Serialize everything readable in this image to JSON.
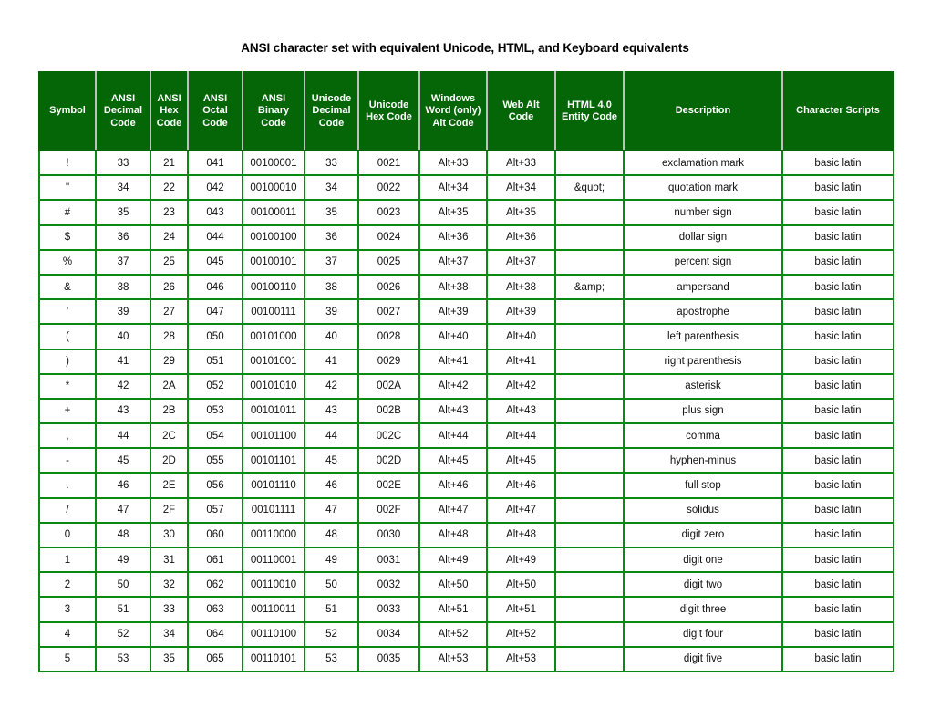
{
  "document": {
    "title": "ANSI character set with equivalent Unicode, HTML, and Keyboard equivalents"
  },
  "colors": {
    "header_background": "#056608",
    "header_text": "#ffffff",
    "header_cell_border": "#c0c0c0",
    "body_cell_border": "#0a8a12",
    "page_background": "#ffffff",
    "body_text": "#111111"
  },
  "table": {
    "columns": [
      {
        "key": "symbol",
        "label": "Symbol"
      },
      {
        "key": "ansi_dec",
        "label": "ANSI Decimal Code"
      },
      {
        "key": "ansi_hex",
        "label": "ANSI Hex Code"
      },
      {
        "key": "ansi_oct",
        "label": "ANSI Octal Code"
      },
      {
        "key": "ansi_bin",
        "label": "ANSI Binary Code"
      },
      {
        "key": "uni_dec",
        "label": "Unicode Decimal Code"
      },
      {
        "key": "uni_hex",
        "label": "Unicode Hex Code"
      },
      {
        "key": "word_alt",
        "label": "Windows Word (only) Alt Code"
      },
      {
        "key": "web_alt",
        "label": "Web Alt Code"
      },
      {
        "key": "html_entity",
        "label": "HTML 4.0 Entity Code"
      },
      {
        "key": "description",
        "label": "Description"
      },
      {
        "key": "scripts",
        "label": "Character Scripts"
      }
    ],
    "rows": [
      {
        "symbol": "!",
        "ansi_dec": "33",
        "ansi_hex": "21",
        "ansi_oct": "041",
        "ansi_bin": "00100001",
        "uni_dec": "33",
        "uni_hex": "0021",
        "word_alt": "Alt+33",
        "web_alt": "Alt+33",
        "html_entity": "",
        "description": "exclamation mark",
        "scripts": "basic latin"
      },
      {
        "symbol": "\"",
        "ansi_dec": "34",
        "ansi_hex": "22",
        "ansi_oct": "042",
        "ansi_bin": "00100010",
        "uni_dec": "34",
        "uni_hex": "0022",
        "word_alt": "Alt+34",
        "web_alt": "Alt+34",
        "html_entity": "&quot;",
        "description": "quotation mark",
        "scripts": "basic latin"
      },
      {
        "symbol": "#",
        "ansi_dec": "35",
        "ansi_hex": "23",
        "ansi_oct": "043",
        "ansi_bin": "00100011",
        "uni_dec": "35",
        "uni_hex": "0023",
        "word_alt": "Alt+35",
        "web_alt": "Alt+35",
        "html_entity": "",
        "description": "number sign",
        "scripts": "basic latin"
      },
      {
        "symbol": "$",
        "ansi_dec": "36",
        "ansi_hex": "24",
        "ansi_oct": "044",
        "ansi_bin": "00100100",
        "uni_dec": "36",
        "uni_hex": "0024",
        "word_alt": "Alt+36",
        "web_alt": "Alt+36",
        "html_entity": "",
        "description": "dollar sign",
        "scripts": "basic latin"
      },
      {
        "symbol": "%",
        "ansi_dec": "37",
        "ansi_hex": "25",
        "ansi_oct": "045",
        "ansi_bin": "00100101",
        "uni_dec": "37",
        "uni_hex": "0025",
        "word_alt": "Alt+37",
        "web_alt": "Alt+37",
        "html_entity": "",
        "description": "percent sign",
        "scripts": "basic latin"
      },
      {
        "symbol": "&",
        "ansi_dec": "38",
        "ansi_hex": "26",
        "ansi_oct": "046",
        "ansi_bin": "00100110",
        "uni_dec": "38",
        "uni_hex": "0026",
        "word_alt": "Alt+38",
        "web_alt": "Alt+38",
        "html_entity": "&amp;",
        "description": "ampersand",
        "scripts": "basic latin"
      },
      {
        "symbol": "'",
        "ansi_dec": "39",
        "ansi_hex": "27",
        "ansi_oct": "047",
        "ansi_bin": "00100111",
        "uni_dec": "39",
        "uni_hex": "0027",
        "word_alt": "Alt+39",
        "web_alt": "Alt+39",
        "html_entity": "",
        "description": "apostrophe",
        "scripts": "basic latin"
      },
      {
        "symbol": "(",
        "ansi_dec": "40",
        "ansi_hex": "28",
        "ansi_oct": "050",
        "ansi_bin": "00101000",
        "uni_dec": "40",
        "uni_hex": "0028",
        "word_alt": "Alt+40",
        "web_alt": "Alt+40",
        "html_entity": "",
        "description": "left parenthesis",
        "scripts": "basic latin"
      },
      {
        "symbol": ")",
        "ansi_dec": "41",
        "ansi_hex": "29",
        "ansi_oct": "051",
        "ansi_bin": "00101001",
        "uni_dec": "41",
        "uni_hex": "0029",
        "word_alt": "Alt+41",
        "web_alt": "Alt+41",
        "html_entity": "",
        "description": "right parenthesis",
        "scripts": "basic latin"
      },
      {
        "symbol": "*",
        "ansi_dec": "42",
        "ansi_hex": "2A",
        "ansi_oct": "052",
        "ansi_bin": "00101010",
        "uni_dec": "42",
        "uni_hex": "002A",
        "word_alt": "Alt+42",
        "web_alt": "Alt+42",
        "html_entity": "",
        "description": "asterisk",
        "scripts": "basic latin"
      },
      {
        "symbol": "+",
        "ansi_dec": "43",
        "ansi_hex": "2B",
        "ansi_oct": "053",
        "ansi_bin": "00101011",
        "uni_dec": "43",
        "uni_hex": "002B",
        "word_alt": "Alt+43",
        "web_alt": "Alt+43",
        "html_entity": "",
        "description": "plus sign",
        "scripts": "basic latin"
      },
      {
        "symbol": ",",
        "ansi_dec": "44",
        "ansi_hex": "2C",
        "ansi_oct": "054",
        "ansi_bin": "00101100",
        "uni_dec": "44",
        "uni_hex": "002C",
        "word_alt": "Alt+44",
        "web_alt": "Alt+44",
        "html_entity": "",
        "description": "comma",
        "scripts": "basic latin"
      },
      {
        "symbol": "-",
        "ansi_dec": "45",
        "ansi_hex": "2D",
        "ansi_oct": "055",
        "ansi_bin": "00101101",
        "uni_dec": "45",
        "uni_hex": "002D",
        "word_alt": "Alt+45",
        "web_alt": "Alt+45",
        "html_entity": "",
        "description": "hyphen-minus",
        "scripts": "basic latin"
      },
      {
        "symbol": ".",
        "ansi_dec": "46",
        "ansi_hex": "2E",
        "ansi_oct": "056",
        "ansi_bin": "00101110",
        "uni_dec": "46",
        "uni_hex": "002E",
        "word_alt": "Alt+46",
        "web_alt": "Alt+46",
        "html_entity": "",
        "description": "full stop",
        "scripts": "basic latin"
      },
      {
        "symbol": "/",
        "ansi_dec": "47",
        "ansi_hex": "2F",
        "ansi_oct": "057",
        "ansi_bin": "00101111",
        "uni_dec": "47",
        "uni_hex": "002F",
        "word_alt": "Alt+47",
        "web_alt": "Alt+47",
        "html_entity": "",
        "description": "solidus",
        "scripts": "basic latin"
      },
      {
        "symbol": "0",
        "ansi_dec": "48",
        "ansi_hex": "30",
        "ansi_oct": "060",
        "ansi_bin": "00110000",
        "uni_dec": "48",
        "uni_hex": "0030",
        "word_alt": "Alt+48",
        "web_alt": "Alt+48",
        "html_entity": "",
        "description": "digit zero",
        "scripts": "basic latin"
      },
      {
        "symbol": "1",
        "ansi_dec": "49",
        "ansi_hex": "31",
        "ansi_oct": "061",
        "ansi_bin": "00110001",
        "uni_dec": "49",
        "uni_hex": "0031",
        "word_alt": "Alt+49",
        "web_alt": "Alt+49",
        "html_entity": "",
        "description": "digit one",
        "scripts": "basic latin"
      },
      {
        "symbol": "2",
        "ansi_dec": "50",
        "ansi_hex": "32",
        "ansi_oct": "062",
        "ansi_bin": "00110010",
        "uni_dec": "50",
        "uni_hex": "0032",
        "word_alt": "Alt+50",
        "web_alt": "Alt+50",
        "html_entity": "",
        "description": "digit two",
        "scripts": "basic latin"
      },
      {
        "symbol": "3",
        "ansi_dec": "51",
        "ansi_hex": "33",
        "ansi_oct": "063",
        "ansi_bin": "00110011",
        "uni_dec": "51",
        "uni_hex": "0033",
        "word_alt": "Alt+51",
        "web_alt": "Alt+51",
        "html_entity": "",
        "description": "digit three",
        "scripts": "basic latin"
      },
      {
        "symbol": "4",
        "ansi_dec": "52",
        "ansi_hex": "34",
        "ansi_oct": "064",
        "ansi_bin": "00110100",
        "uni_dec": "52",
        "uni_hex": "0034",
        "word_alt": "Alt+52",
        "web_alt": "Alt+52",
        "html_entity": "",
        "description": "digit four",
        "scripts": "basic latin"
      },
      {
        "symbol": "5",
        "ansi_dec": "53",
        "ansi_hex": "35",
        "ansi_oct": "065",
        "ansi_bin": "00110101",
        "uni_dec": "53",
        "uni_hex": "0035",
        "word_alt": "Alt+53",
        "web_alt": "Alt+53",
        "html_entity": "",
        "description": "digit five",
        "scripts": "basic latin"
      }
    ]
  }
}
